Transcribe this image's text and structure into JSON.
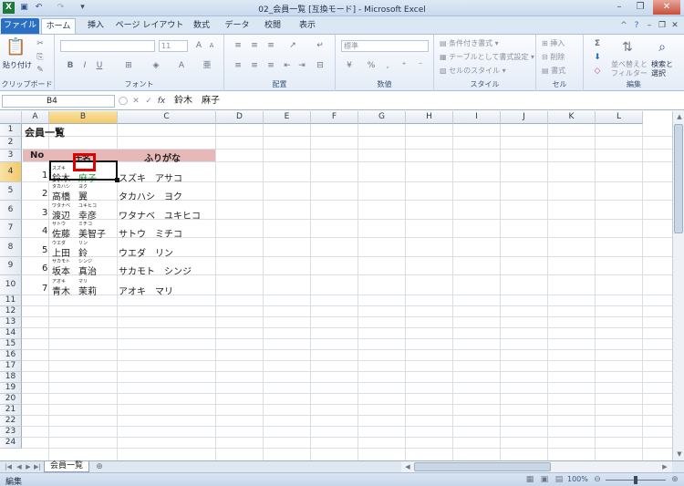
{
  "window": {
    "title": "02_会員一覧 [互換モード] - Microsoft Excel",
    "app_icon": "X"
  },
  "ribbon_tabs": [
    "ファイル",
    "ホーム",
    "挿入",
    "ページ レイアウト",
    "数式",
    "データ",
    "校閲",
    "表示"
  ],
  "ribbon": {
    "clipboard": {
      "label": "クリップボード",
      "paste": "貼り付け"
    },
    "font": {
      "label": "フォント",
      "size": "11"
    },
    "alignment": {
      "label": "配置"
    },
    "number": {
      "label": "数値",
      "format": "標準"
    },
    "styles": {
      "label": "スタイル",
      "conditional": "条件付き書式",
      "table": "テーブルとして書式設定",
      "cell": "セルのスタイル"
    },
    "cells": {
      "label": "セル",
      "insert": "挿入",
      "delete": "削除",
      "format": "書式"
    },
    "editing": {
      "label": "編集",
      "sort1": "並べ替えと",
      "sort2": "フィルター",
      "find1": "検索と",
      "find2": "選択"
    }
  },
  "formula_bar": {
    "name_box": "B4",
    "value": "鈴木　麻子"
  },
  "columns": [
    "A",
    "B",
    "C",
    "D",
    "E",
    "F",
    "G",
    "H",
    "I",
    "J",
    "K",
    "L"
  ],
  "rows": [
    "1",
    "2",
    "3",
    "4",
    "5",
    "6",
    "7",
    "8",
    "9",
    "10",
    "11",
    "12",
    "13",
    "14",
    "15",
    "16",
    "17",
    "18",
    "19",
    "20",
    "21",
    "22",
    "23",
    "24"
  ],
  "sheet": {
    "title": "会員一覧",
    "headers": {
      "no": "No",
      "name": "氏名",
      "kana": "ふりがな"
    },
    "members": [
      {
        "no": "1",
        "last": "鈴木",
        "first": "麻子",
        "furi_last": "スズキ",
        "furi_first": "",
        "kana": "スズキ　アサコ"
      },
      {
        "no": "2",
        "last": "高橋",
        "first": "翼",
        "furi_last": "タカハシ",
        "furi_first": "ヨク",
        "kana": "タカハシ　ヨク"
      },
      {
        "no": "3",
        "last": "渡辺",
        "first": "幸彦",
        "furi_last": "ワタナベ",
        "furi_first": "ユキヒコ",
        "kana": "ワタナベ　ユキヒコ"
      },
      {
        "no": "4",
        "last": "佐藤",
        "first": "美智子",
        "furi_last": "サトウ",
        "furi_first": "ミチコ",
        "kana": "サトウ　ミチコ"
      },
      {
        "no": "5",
        "last": "上田",
        "first": "鈴",
        "furi_last": "ウエダ",
        "furi_first": "リン",
        "kana": "ウエダ　リン"
      },
      {
        "no": "6",
        "last": "坂本",
        "first": "真治",
        "furi_last": "サカモト",
        "furi_first": "シンジ",
        "kana": "サカモト　シンジ"
      },
      {
        "no": "7",
        "last": "青木",
        "first": "茉莉",
        "furi_last": "アオキ",
        "furi_first": "マリ",
        "kana": "アオキ　マリ"
      }
    ]
  },
  "sheet_tab": "会員一覧",
  "status": {
    "mode": "編集",
    "zoom": "100%"
  },
  "colors": {
    "header_fill": "#e6b8b7",
    "selection": "#f3c96a",
    "highlight_box": "#e00000"
  }
}
